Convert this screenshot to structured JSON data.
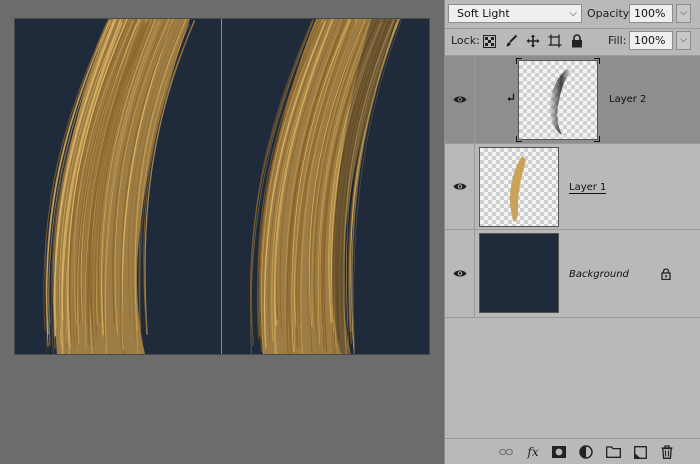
{
  "toolbar": {
    "blend_mode": "Soft Light",
    "opacity_label": "Opacity:",
    "opacity_value": "100%",
    "lock_label": "Lock:",
    "fill_label": "Fill:",
    "fill_value": "100%"
  },
  "lock_icons": [
    "lock-transparent-pixels-icon",
    "lock-image-pixels-icon",
    "lock-position-icon",
    "lock-artboard-icon",
    "lock-all-icon"
  ],
  "layers": [
    {
      "name": "Layer 2",
      "selected": true,
      "clipped": true,
      "visible": true
    },
    {
      "name": "Layer 1",
      "selected": false,
      "clipped": false,
      "visible": true
    },
    {
      "name": "Background",
      "selected": false,
      "locked": true,
      "visible": true
    }
  ],
  "footer_icons": [
    "link-layers-icon",
    "fx-icon",
    "layer-mask-icon",
    "adjustment-layer-icon",
    "new-group-icon",
    "new-layer-icon",
    "delete-layer-icon"
  ],
  "footer": {
    "fx_label": "fx"
  },
  "colors": {
    "canvas_bg": "#1f2a3a",
    "hair": "#c79a4a",
    "panel_bg": "#b9b9b9",
    "selected_row": "#8e8e8e",
    "workspace_bg": "#6c6c6c"
  }
}
